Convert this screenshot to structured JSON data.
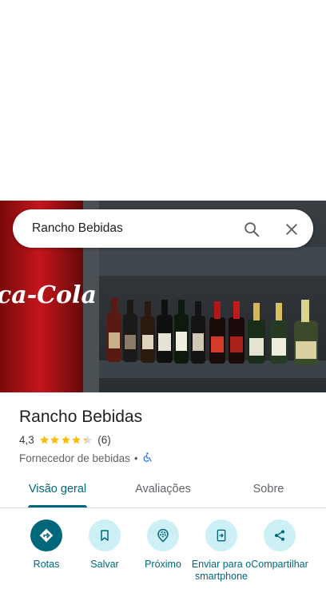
{
  "search": {
    "query": "Rancho Bebidas"
  },
  "place": {
    "title": "Rancho Bebidas",
    "rating": "4,3",
    "stars": 4.3,
    "review_count": "(6)",
    "category": "Fornecedor de bebidas",
    "separator": "•"
  },
  "photo": {
    "sign_text": "ca-Cola"
  },
  "tabs": [
    {
      "label": "Visão geral",
      "active": true
    },
    {
      "label": "Avaliações",
      "active": false
    },
    {
      "label": "Sobre",
      "active": false
    }
  ],
  "actions": [
    {
      "label": "Rotas",
      "icon": "directions-icon"
    },
    {
      "label": "Salvar",
      "icon": "bookmark-icon"
    },
    {
      "label": "Próximo",
      "icon": "nearby-icon"
    },
    {
      "label": "Enviar para o smartphone",
      "icon": "send-to-phone-icon"
    },
    {
      "label": "Compartilhar",
      "icon": "share-icon"
    }
  ],
  "colors": {
    "accent": "#00687a",
    "action_bg": "#cdeff6",
    "star": "#fbbc04",
    "accessible": "#1a73e8"
  }
}
